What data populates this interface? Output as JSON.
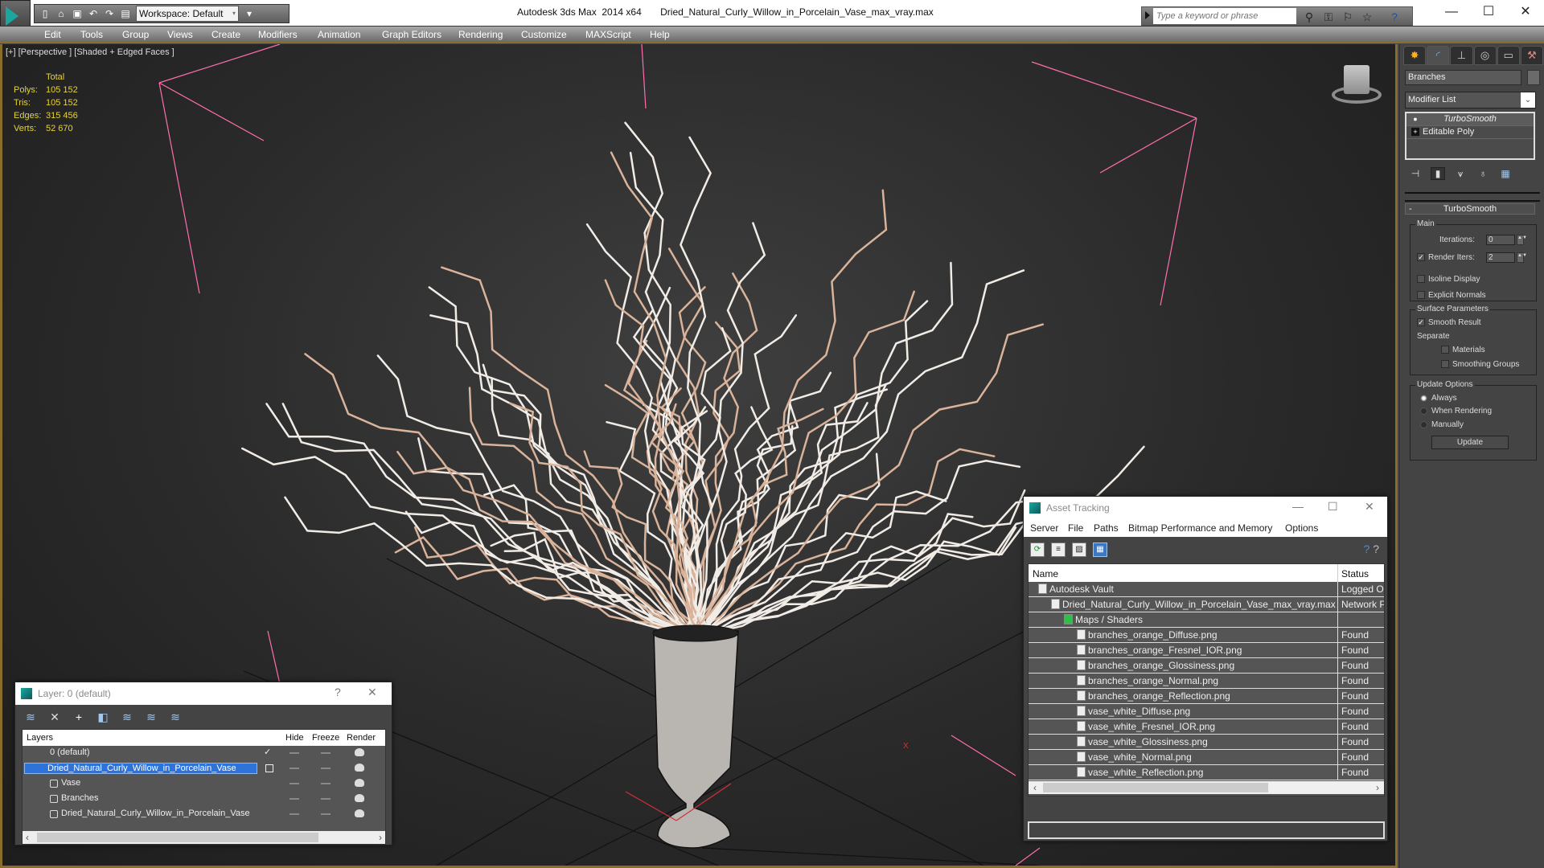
{
  "app": {
    "title": "Autodesk 3ds Max  2014 x64",
    "file_name": "Dried_Natural_Curly_Willow_in_Porcelain_Vase_max_vray.max",
    "workspace": "Workspace: Default",
    "search_placeholder": "Type a keyword or phrase",
    "window_controls": [
      "—",
      "☐",
      "✕"
    ]
  },
  "menu": [
    "Edit",
    "Tools",
    "Group",
    "Views",
    "Create",
    "Modifiers",
    "Animation",
    "Graph Editors",
    "Rendering",
    "Customize",
    "MAXScript",
    "Help"
  ],
  "viewport": {
    "label": "[+] [Perspective ] [Shaded + Edged Faces ]",
    "stats": {
      "header": "Total",
      "rows": [
        {
          "key": "Polys:",
          "value": "105 152"
        },
        {
          "key": "Tris:",
          "value": "105 152"
        },
        {
          "key": "Edges:",
          "value": "315 456"
        },
        {
          "key": "Verts:",
          "value": "52 670"
        }
      ]
    },
    "axis_label": "X"
  },
  "command_panel": {
    "tabs": [
      "create",
      "modify",
      "hierarchy",
      "motion",
      "display",
      "utilities"
    ],
    "object_name": "Branches",
    "modifier_list": "Modifier List",
    "stack": [
      {
        "label": "TurboSmooth",
        "selected": true
      },
      {
        "label": "Editable Poly",
        "selected": false
      }
    ],
    "turbosmooth": {
      "title": "TurboSmooth",
      "main_label": "Main",
      "iterations_label": "Iterations:",
      "iterations_value": "0",
      "render_iters_label": "Render Iters:",
      "render_iters_value": "2",
      "render_iters_checked": true,
      "isoline_label": "Isoline Display",
      "isoline_checked": false,
      "explicit_normals_label": "Explicit Normals",
      "explicit_normals_checked": false,
      "surface_params_label": "Surface Parameters",
      "smooth_result_label": "Smooth Result",
      "smooth_result_checked": true,
      "separate_label": "Separate",
      "materials_label": "Materials",
      "smoothing_groups_label": "Smoothing Groups",
      "update_options_label": "Update Options",
      "update_options": [
        "Always",
        "When Rendering",
        "Manually"
      ],
      "update_selected": "Always",
      "update_button": "Update"
    }
  },
  "layer_window": {
    "title": "Layer: 0 (default)",
    "help": "?",
    "close": "✕",
    "columns": [
      "Layers",
      "Hide",
      "Freeze",
      "Render"
    ],
    "rows": [
      {
        "name": "0 (default)",
        "type": "layer",
        "current": true
      },
      {
        "name": "Dried_Natural_Curly_Willow_in_Porcelain_Vase",
        "type": "layer",
        "selected": true
      },
      {
        "name": "Vase",
        "type": "object"
      },
      {
        "name": "Branches",
        "type": "object"
      },
      {
        "name": "Dried_Natural_Curly_Willow_in_Porcelain_Vase",
        "type": "object"
      }
    ]
  },
  "asset_window": {
    "title": "Asset Tracking",
    "menu": [
      "Server",
      "File",
      "Paths",
      "Bitmap Performance and Memory",
      "Options"
    ],
    "columns": [
      "Name",
      "Status"
    ],
    "rows": [
      {
        "name": "Autodesk Vault",
        "status": "Logged O",
        "indent": 1
      },
      {
        "name": "Dried_Natural_Curly_Willow_in_Porcelain_Vase_max_vray.max",
        "status": "Network P",
        "indent": 2
      },
      {
        "name": "Maps / Shaders",
        "status": "",
        "indent": 3
      },
      {
        "name": "branches_orange_Diffuse.png",
        "status": "Found",
        "indent": 4
      },
      {
        "name": "branches_orange_Fresnel_IOR.png",
        "status": "Found",
        "indent": 4
      },
      {
        "name": "branches_orange_Glossiness.png",
        "status": "Found",
        "indent": 4
      },
      {
        "name": "branches_orange_Normal.png",
        "status": "Found",
        "indent": 4
      },
      {
        "name": "branches_orange_Reflection.png",
        "status": "Found",
        "indent": 4
      },
      {
        "name": "vase_white_Diffuse.png",
        "status": "Found",
        "indent": 4
      },
      {
        "name": "vase_white_Fresnel_IOR.png",
        "status": "Found",
        "indent": 4
      },
      {
        "name": "vase_white_Glossiness.png",
        "status": "Found",
        "indent": 4
      },
      {
        "name": "vase_white_Normal.png",
        "status": "Found",
        "indent": 4
      },
      {
        "name": "vase_white_Reflection.png",
        "status": "Found",
        "indent": 4
      }
    ]
  },
  "colors": {
    "accent_frame": "#8a6d2b",
    "stats_text": "#e6d33a",
    "selection_blue": "#2e73d9",
    "camera_lines": "#ff6fae"
  }
}
